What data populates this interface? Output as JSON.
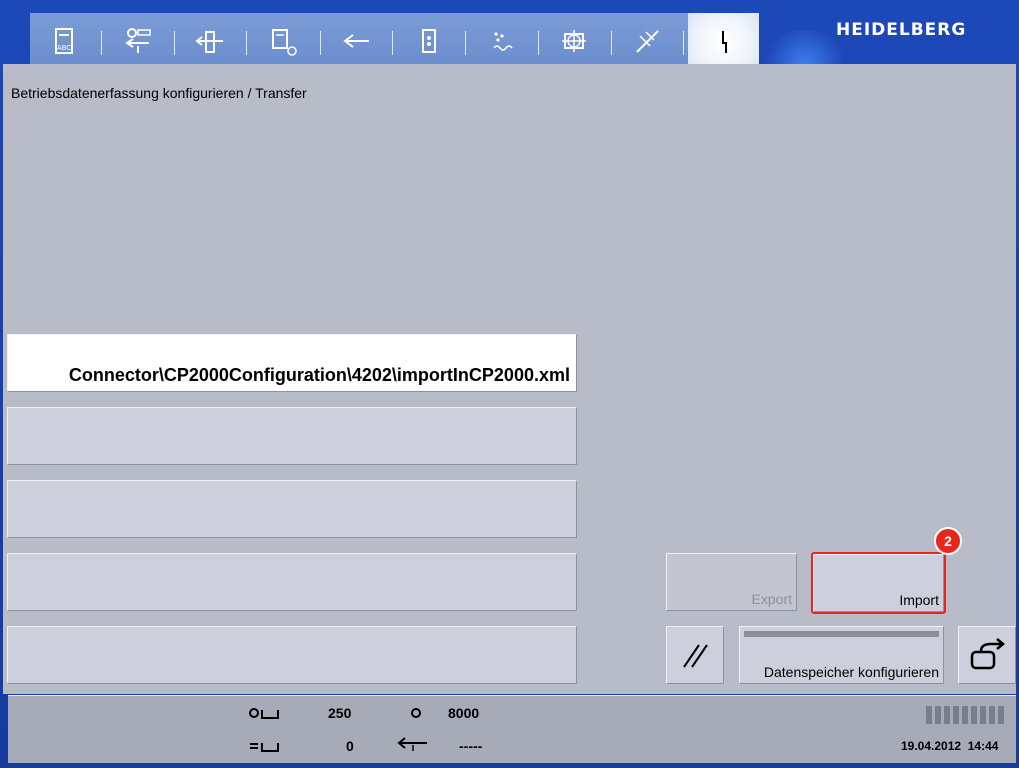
{
  "header": {
    "brand": "HEIDELBERG",
    "toolbar_icons": [
      "document-abc-icon",
      "feed-settings-icon",
      "paper-transport-icon",
      "print-sheet-icon",
      "back-arrow-icon",
      "ink-unit-icon",
      "dampening-icon",
      "register-icon",
      "washup-icon",
      "service-icon"
    ]
  },
  "page": {
    "title": "Betriebsdatenerfassung konfigurieren / Transfer"
  },
  "fields": {
    "path_value": "Connector\\CP2000Configuration\\4202\\importInCP2000.xml"
  },
  "buttons": {
    "export_label": "Export",
    "import_label": "Import",
    "datastore_label": "Datenspeicher konfigurieren"
  },
  "callout": {
    "step": "2"
  },
  "status": {
    "counter_left_1": "250",
    "counter_left_2": "0",
    "counter_right_1": "8000",
    "counter_right_2": "-----",
    "date": "19.04.2012",
    "time": "14:44"
  },
  "colors": {
    "accent_red": "#e8261c",
    "frame_blue": "#1d48b8",
    "panel_gray": "#b8bcc8"
  }
}
